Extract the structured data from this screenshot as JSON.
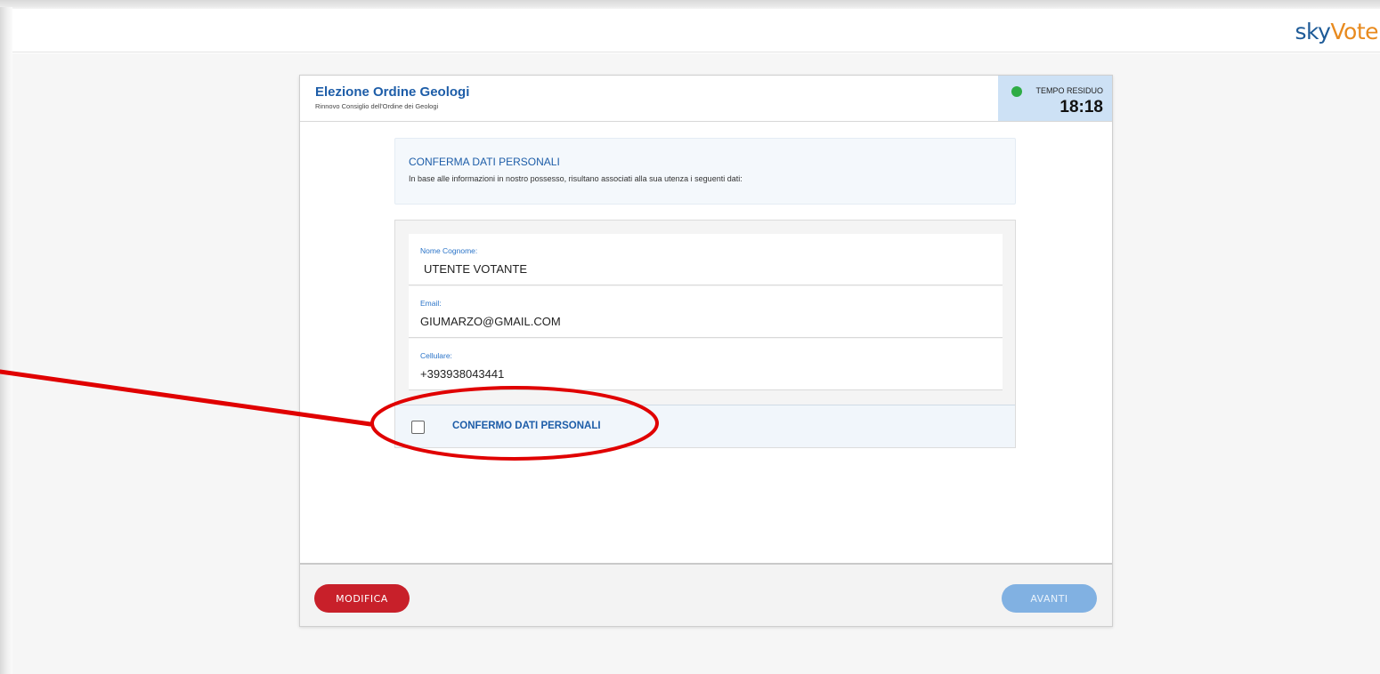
{
  "brand": {
    "logo_part1": "sky",
    "logo_part2": "Vote",
    "color_primary": "#1d5a97",
    "color_accent": "#e88a1e"
  },
  "election": {
    "title": "Elezione Ordine Geologi",
    "subtitle": "Rinnovo Consiglio dell'Ordine dei Geologi"
  },
  "timer": {
    "label": "TEMPO RESIDUO",
    "value": "18:18",
    "status_color": "#2eac45"
  },
  "info": {
    "title": "CONFERMA DATI PERSONALI",
    "text": "In base alle informazioni in nostro possesso, risultano associati alla sua utenza i seguenti dati:"
  },
  "fields": [
    {
      "label": "Nome Cognome:",
      "value": "UTENTE VOTANTE"
    },
    {
      "label": "Email:",
      "value": "GIUMARZO@GMAIL.COM"
    },
    {
      "label": "Cellulare:",
      "value": "+393938043441"
    }
  ],
  "confirm": {
    "label": "CONFERMO DATI PERSONALI",
    "checked": false
  },
  "buttons": {
    "modifica": "MODIFICA",
    "avanti": "AVANTI",
    "avanti_enabled": false
  },
  "annotation": {
    "type": "red-arrow-and-ellipse",
    "color": "#e00000"
  }
}
